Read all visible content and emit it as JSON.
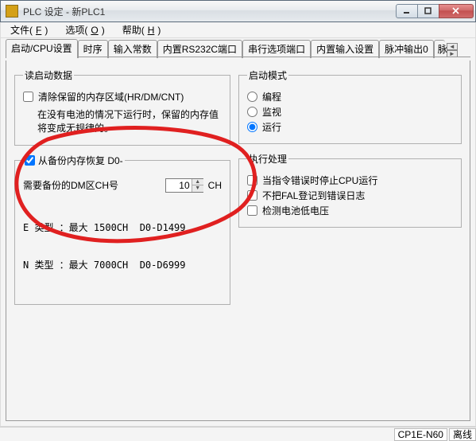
{
  "window": {
    "title": "PLC 设定 - 新PLC1"
  },
  "menu": {
    "file": "文件(",
    "file_key": "F",
    "options": "选项(",
    "options_key": "O",
    "help": "帮助(",
    "help_key": "H",
    "close_paren": ")"
  },
  "tabs": {
    "t0": "启动/CPU设置",
    "t1": "时序",
    "t2": "输入常数",
    "t3": "内置RS232C端口",
    "t4": "串行选项端口",
    "t5": "内置输入设置",
    "t6": "脉冲输出0",
    "t7": "脉"
  },
  "groups": {
    "read_boot": "读启动数据",
    "restore": "从备份内存恢复 D0-",
    "boot_mode": "启动模式",
    "exec": "执行处理"
  },
  "read_boot": {
    "clear_label": "清除保留的内存区域(HR/DM/CNT)",
    "note_l1": "在没有电池的情况下运行时，保留的内存值",
    "note_l2": "将变成无规律的。"
  },
  "restore": {
    "dm_label": "需要备份的DM区CH号",
    "dm_value": "10",
    "dm_unit": "CH",
    "type_e": "E 类型 ：最大 1500CH  D0-D1499",
    "type_n": "N 类型 ：最大 7000CH  D0-D6999"
  },
  "boot_mode": {
    "program": "编程",
    "monitor": "监视",
    "run": "运行"
  },
  "exec": {
    "stop_err": "当指令错误时停止CPU运行",
    "fal": "不把FAL登记到错误日志",
    "battery": "检测电池低电压"
  },
  "status": {
    "model": "CP1E-N60",
    "conn": "离线"
  }
}
